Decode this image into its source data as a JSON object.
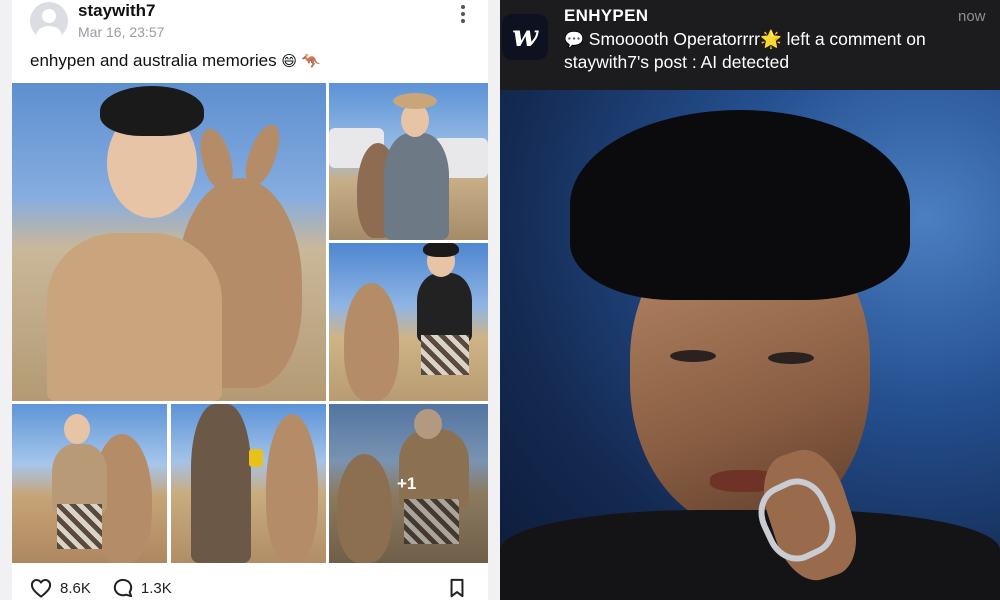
{
  "post": {
    "username": "staywith7",
    "timestamp": "Mar 16, 23:57",
    "caption_text": "enhypen and australia memories",
    "caption_emoji": "😄 🦘",
    "extra_count": "+1",
    "likes": "8.6K",
    "comments": "1.3K"
  },
  "notification": {
    "app_name": "ENHYPEN",
    "app_icon_letter": "w",
    "time": "now",
    "body_prefix_emoji": "💬",
    "body_text": "Smooooth Operatorrrr🌟 left a comment on staywith7's post : AI detected"
  },
  "icons": {
    "more": "more-vertical-icon",
    "like": "heart-icon",
    "comment": "comment-bubble-icon",
    "bookmark": "bookmark-icon"
  },
  "colors": {
    "notification_bg": "#1c1c1e",
    "app_icon_bg": "#0e1220",
    "muted_text": "#9a9ba4"
  }
}
